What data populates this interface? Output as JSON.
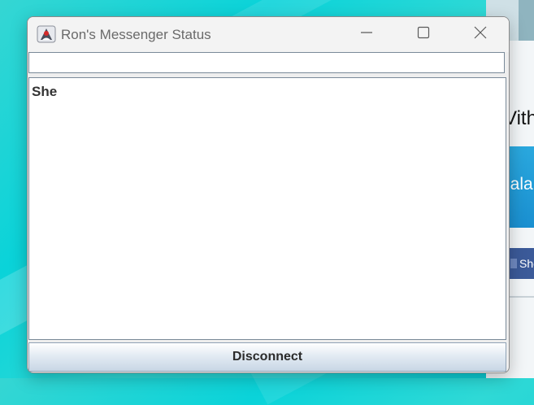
{
  "window": {
    "title": "Ron's Messenger Status",
    "app_icon": "java-duke-icon",
    "controls": {
      "minimize": "minimize-icon",
      "maximize": "maximize-icon",
      "close": "close-icon"
    }
  },
  "status_field": {
    "value": ""
  },
  "messages": [
    "She"
  ],
  "disconnect_button": {
    "label": "Disconnect"
  },
  "background_app": {
    "heading_fragment": "Vith",
    "banner_fragment": "hala",
    "share_fragment": "She"
  },
  "colors": {
    "desktop_accent": "#0ad3d9",
    "banner_blue": "#1a8fd0",
    "share_blue": "#3b5a99",
    "title_text": "#6a6a6a"
  }
}
